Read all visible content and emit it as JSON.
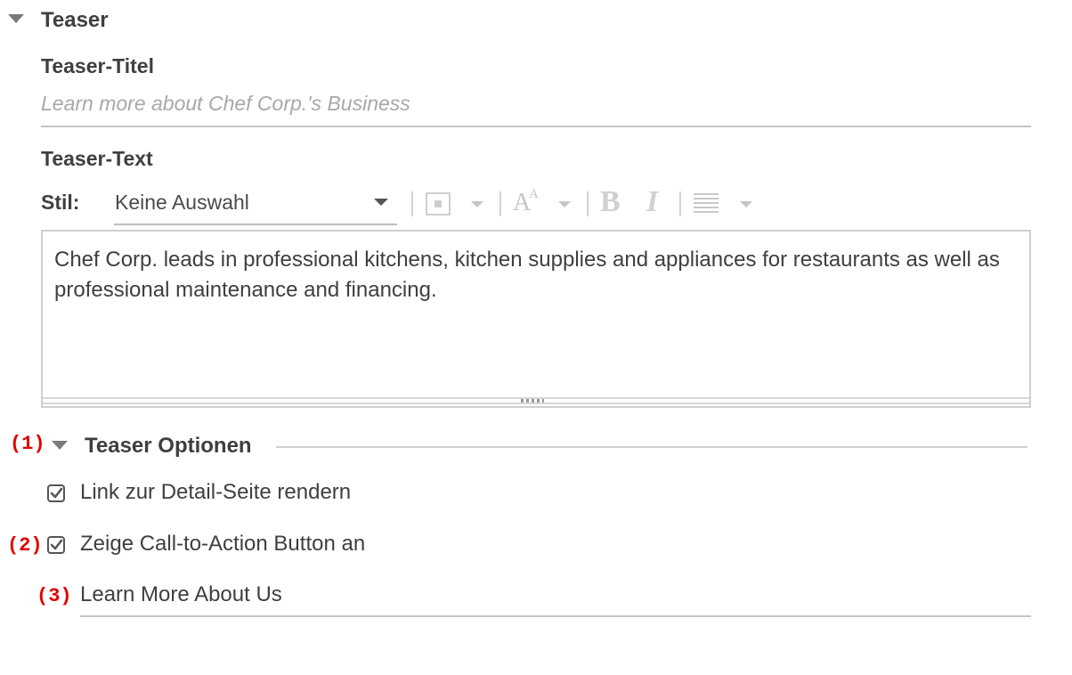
{
  "teaser_section": {
    "title": "Teaser",
    "title_field": {
      "label": "Teaser-Titel",
      "placeholder": "Learn more about Chef Corp.'s Business"
    },
    "text_field": {
      "label": "Teaser-Text",
      "toolbar": {
        "style_label": "Stil:",
        "style_value": "Keine Auswahl",
        "font_size_glyph": "A",
        "font_size_small_glyph": "A",
        "bold_glyph": "B",
        "italic_glyph": "I"
      },
      "content": "Chef Corp. leads in professional kitchens, kitchen supplies and appliances for restaurants as well as professional maintenance and financing."
    }
  },
  "options_section": {
    "marker": "(1)",
    "title": "Teaser Optionen",
    "link_checkbox": {
      "label": "Link zur Detail-Seite rendern",
      "checked": true
    },
    "cta_checkbox": {
      "marker": "(2)",
      "label": "Zeige Call-to-Action Button an",
      "checked": true
    },
    "cta_text": {
      "marker": "(3)",
      "value": "Learn More About Us"
    }
  },
  "colors": {
    "marker": "#e00000",
    "text": "#3f3f3f",
    "placeholder": "#a8a8a8"
  },
  "icons": [
    "collapse-triangle-icon",
    "dropdown-arrow-icon",
    "block-style-icon",
    "font-size-icon",
    "bold-icon",
    "italic-icon",
    "align-icon",
    "resize-grip-icon",
    "checkbox-checked-icon"
  ]
}
